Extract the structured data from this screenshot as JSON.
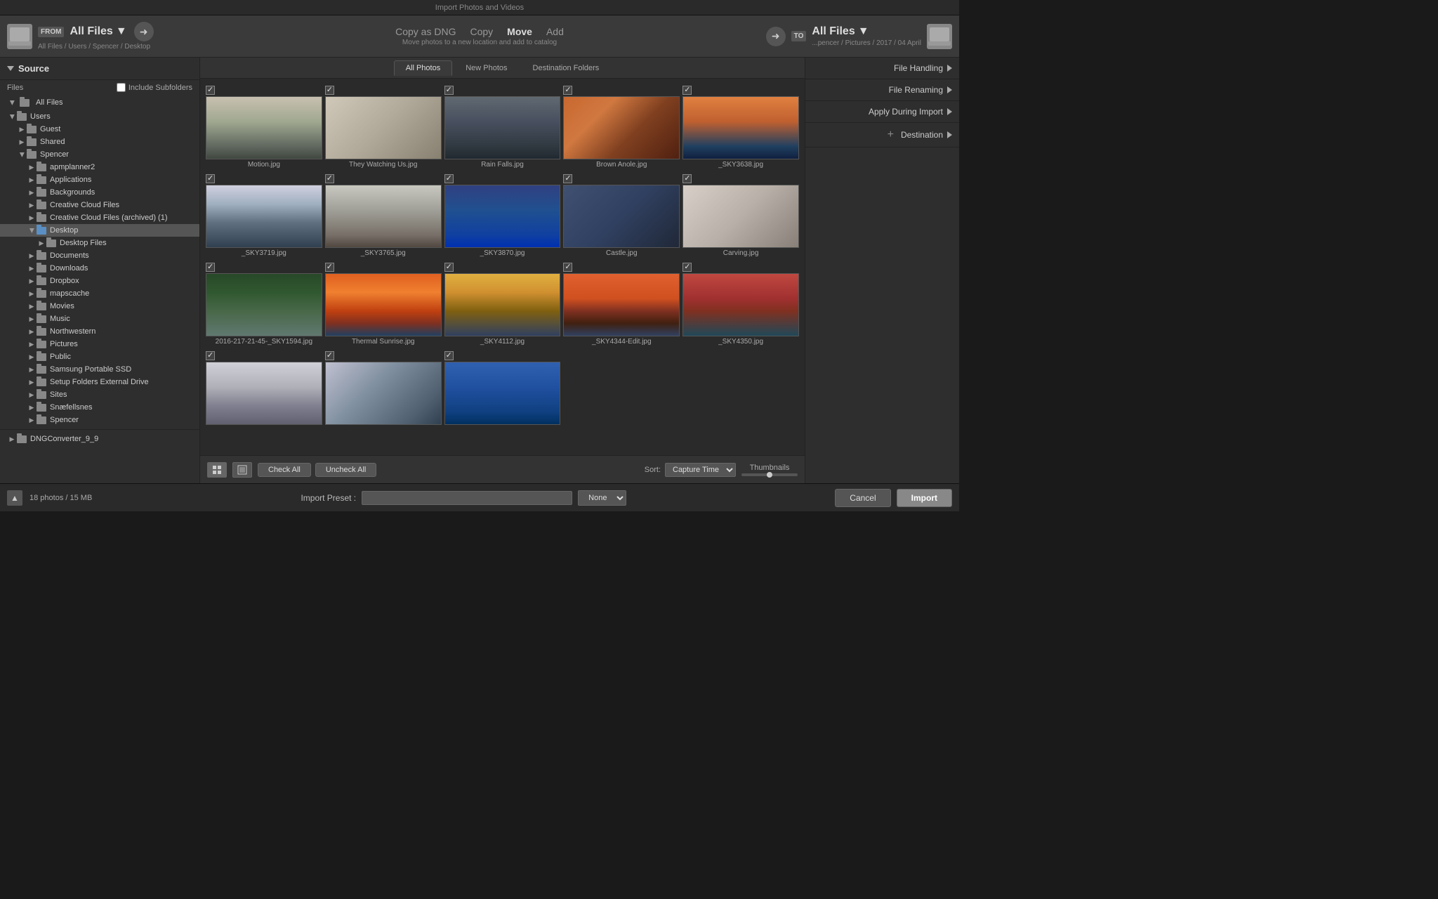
{
  "titleBar": {
    "text": "Import Photos and Videos"
  },
  "toolbar": {
    "fromBadge": "FROM",
    "allFiles": "All Files",
    "allFilesDropdown": "▼",
    "breadcrumb": "All Files / Users / Spencer / Desktop",
    "actions": {
      "copyAsDNG": "Copy as DNG",
      "copy": "Copy",
      "move": "Move",
      "add": "Add"
    },
    "subtitle": "Move photos to a new location and add to catalog",
    "toBadge": "TO",
    "toAllFiles": "All Files",
    "toBreadcrumb": "...pencer / Pictures / 2017 / 04 April"
  },
  "sidebar": {
    "title": "Source",
    "filesLabel": "Files",
    "includeSubfolders": "Include Subfolders",
    "allFiles": "All Files",
    "users": "Users",
    "guest": "Guest",
    "shared": "Shared",
    "spencer": "Spencer",
    "apmplanner2": "apmplanner2",
    "applications": "Applications",
    "backgrounds": "Backgrounds",
    "creativeCloud": "Creative Cloud Files",
    "creativeCloudArchived": "Creative Cloud Files (archived) (1)",
    "desktop": "Desktop",
    "desktopFiles": "Desktop Files",
    "documents": "Documents",
    "downloads": "Downloads",
    "dropbox": "Dropbox",
    "mapscache": "mapscache",
    "movies": "Movies",
    "music": "Music",
    "northwestern": "Northwestern",
    "pictures": "Pictures",
    "public": "Public",
    "samsungPortable": "Samsung Portable SSD",
    "setupFolders": "Setup Folders External Drive",
    "sites": "Sites",
    "snaefellsnes": "Snæfellsnes",
    "spencerSub": "Spencer",
    "dngConverter": "DNGConverter_9_9"
  },
  "rightPanel": {
    "fileHandling": "File Handling",
    "fileRenaming": "File Renaming",
    "applyDuringImport": "Apply During Import",
    "destination": "Destination"
  },
  "tabs": {
    "allPhotos": "All Photos",
    "newPhotos": "New Photos",
    "destinationFolders": "Destination Folders"
  },
  "photos": [
    {
      "id": "motion",
      "label": "Motion.jpg",
      "checked": true,
      "colorClass": "photo-motion"
    },
    {
      "id": "they-watching",
      "label": "They Watching Us.jpg",
      "checked": true,
      "colorClass": "photo-they-watching"
    },
    {
      "id": "rain-falls",
      "label": "Rain Falls.jpg",
      "checked": true,
      "colorClass": "photo-rain-falls"
    },
    {
      "id": "brown-anole",
      "label": "Brown Anole.jpg",
      "checked": true,
      "colorClass": "photo-brown-anole"
    },
    {
      "id": "sky3638",
      "label": "_SKY3638.jpg",
      "checked": true,
      "colorClass": "photo-sky3638"
    },
    {
      "id": "sky3719",
      "label": "_SKY3719.jpg",
      "checked": true,
      "colorClass": "photo-sky3719"
    },
    {
      "id": "sky3765",
      "label": "_SKY3765.jpg",
      "checked": true,
      "colorClass": "photo-sky3765"
    },
    {
      "id": "sky3870",
      "label": "_SKY3870.jpg",
      "checked": true,
      "colorClass": "photo-sky3870"
    },
    {
      "id": "castle",
      "label": "Castle.jpg",
      "checked": true,
      "colorClass": "photo-castle"
    },
    {
      "id": "carving",
      "label": "Carving.jpg",
      "checked": true,
      "colorClass": "photo-carving"
    },
    {
      "id": "sky1594",
      "label": "2016-217-21-45-_SKY1594.jpg",
      "checked": true,
      "colorClass": "photo-sky1594"
    },
    {
      "id": "thermal",
      "label": "Thermal Sunrise.jpg",
      "checked": true,
      "colorClass": "photo-thermal"
    },
    {
      "id": "sky4112",
      "label": "_SKY4112.jpg",
      "checked": true,
      "colorClass": "photo-sky4112"
    },
    {
      "id": "sky4344",
      "label": "_SKY4344-Edit.jpg",
      "checked": true,
      "colorClass": "photo-sky4344"
    },
    {
      "id": "sky4350",
      "label": "_SKY4350.jpg",
      "checked": true,
      "colorClass": "photo-sky4350"
    },
    {
      "id": "mountain1",
      "label": "",
      "checked": true,
      "colorClass": "photo-mountain1"
    },
    {
      "id": "mountain2",
      "label": "",
      "checked": true,
      "colorClass": "photo-mountain2"
    },
    {
      "id": "mountain3",
      "label": "",
      "checked": true,
      "colorClass": "photo-mountain3"
    }
  ],
  "bottomBar": {
    "checkAll": "Check All",
    "uncheckAll": "Uncheck All",
    "sortLabel": "Sort:",
    "sortValue": "Capture Time",
    "thumbnailsLabel": "Thumbnails"
  },
  "veryBottom": {
    "photoCount": "18 photos / 15 MB",
    "importPresetLabel": "Import Preset :",
    "importPresetValue": "",
    "importPresetOption": "None",
    "cancelBtn": "Cancel",
    "importBtn": "Import"
  }
}
